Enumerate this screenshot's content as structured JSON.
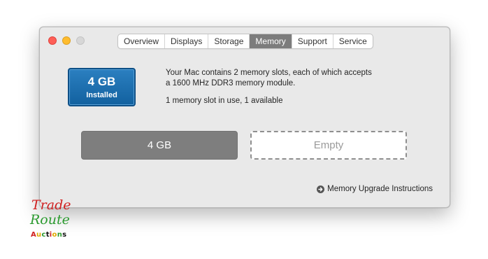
{
  "window": {
    "traffic_lights": {
      "close_color": "#fe5f57",
      "minimize_color": "#febc2e",
      "zoom_color": "#d7d7d7"
    },
    "tabs": [
      {
        "label": "Overview",
        "active": false
      },
      {
        "label": "Displays",
        "active": false
      },
      {
        "label": "Storage",
        "active": false
      },
      {
        "label": "Memory",
        "active": true
      },
      {
        "label": "Support",
        "active": false
      },
      {
        "label": "Service",
        "active": false
      }
    ]
  },
  "memory": {
    "badge": {
      "size": "4 GB",
      "status": "Installed",
      "color": "#1a6fb0"
    },
    "description_line1": "Your Mac contains 2 memory slots, each of which accepts",
    "description_line2": "a 1600 MHz DDR3 memory module.",
    "usage": "1 memory slot in use, 1 available",
    "slots": [
      {
        "label": "4 GB",
        "state": "filled"
      },
      {
        "label": "Empty",
        "state": "empty"
      }
    ],
    "upgrade_link": {
      "icon": "arrow-circle-right-icon",
      "label": "Memory Upgrade Instructions"
    }
  },
  "watermark": {
    "line1": "Trade",
    "line2": "Route",
    "line3": "Auctions"
  }
}
